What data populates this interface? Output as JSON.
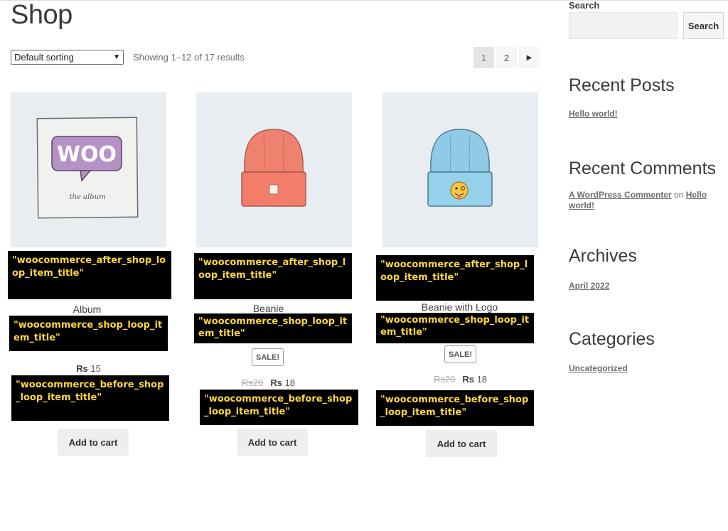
{
  "page": {
    "title": "Shop"
  },
  "toolbar": {
    "sort_value": "Default sorting",
    "result_count": "Showing 1–12 of 17 results",
    "pages": [
      "1",
      "2"
    ]
  },
  "hooks": {
    "after_title": "\"woocommerce_after_shop_loop_item_title\"",
    "item_title": "\"woocommerce_shop_loop_item_title\"",
    "before_title": "\"woocommerce_before_shop_loop_item_title\""
  },
  "products": [
    {
      "name": "Album",
      "price_symbol": "Rs",
      "price": "15",
      "button": "Add to cart",
      "image": "woo-album-icon"
    },
    {
      "name": "Beanie",
      "sale_badge": "SALE!",
      "old_symbol": "Rs",
      "old_price": "20",
      "price_symbol": "Rs",
      "price": "18",
      "button": "Add to cart",
      "image": "red-beanie-icon"
    },
    {
      "name": "Beanie with Logo",
      "sale_badge": "SALE!",
      "old_symbol": "Rs",
      "old_price": "20",
      "price_symbol": "Rs",
      "price": "18",
      "button": "Add to cart",
      "image": "blue-beanie-icon"
    }
  ],
  "album_art": {
    "logo": "WOO",
    "caption": "the album"
  },
  "sidebar": {
    "search_label": "Search",
    "search_button": "Search",
    "search_value": "",
    "recent_posts_title": "Recent Posts",
    "recent_posts": [
      "Hello world!"
    ],
    "recent_comments_title": "Recent Comments",
    "comment": {
      "author": "A WordPress Commenter",
      "joiner": "on",
      "post": "Hello world!"
    },
    "archives_title": "Archives",
    "archives": [
      "April 2022"
    ],
    "categories_title": "Categories",
    "categories": [
      "Uncategorized"
    ]
  }
}
